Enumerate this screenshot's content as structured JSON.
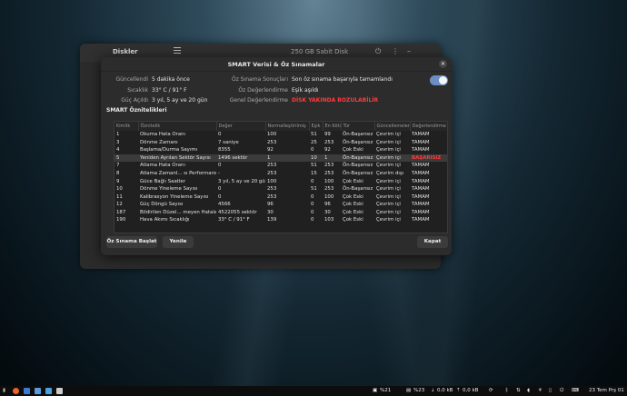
{
  "background_window": {
    "title": "Diskler",
    "subtitle": "250 GB Sabit Disk"
  },
  "dialog": {
    "title": "SMART Verisi & Öz Sınamalar",
    "info_left": [
      {
        "label": "Güncellendi",
        "value": "5 dakika önce"
      },
      {
        "label": "Sıcaklık",
        "value": "33° C / 91° F"
      },
      {
        "label": "Güç Açıldı",
        "value": "3 yıl, 5 ay ve 20 gün"
      }
    ],
    "info_right": [
      {
        "label": "Öz Sınama Sonuçları",
        "value": "Son öz sınama başarıyla tamamlandı"
      },
      {
        "label": "Öz Değerlendirme",
        "value": "Eşik aşıldı"
      },
      {
        "label": "Genel Değerlendirme",
        "value": "DİSK YAKINDA BOZULABİLİR"
      }
    ],
    "toggle_on": true,
    "section_title": "SMART Öznitelikleri",
    "columns": [
      "Kimlik",
      "Öznitelik",
      "Değer",
      "Normalleştirilmiş",
      "Eşik",
      "En Kötü",
      "Tür",
      "Güncellemeler",
      "Değerlendirme"
    ],
    "rows": [
      [
        "1",
        "Okuma Hata Oranı",
        "0",
        "100",
        "51",
        "99",
        "Ön-Başarısız",
        "Çevrim içi",
        "TAMAM"
      ],
      [
        "3",
        "Dönme Zamanı",
        "7 saniye",
        "253",
        "25",
        "253",
        "Ön-Başarısız",
        "Çevrim içi",
        "TAMAM"
      ],
      [
        "4",
        "Başlama/Durma Sayımı",
        "8355",
        "92",
        "0",
        "92",
        "Çok Eski",
        "Çevrim içi",
        "TAMAM"
      ],
      [
        "5",
        "Yeniden Ayrılan Sektör Sayısı",
        "1496 sektör",
        "1",
        "10",
        "1",
        "Ön-Başarısız",
        "Çevrim içi",
        "BAŞARISIZ"
      ],
      [
        "7",
        "Atlama Hata Oranı",
        "0",
        "253",
        "51",
        "253",
        "Ön-Başarısız",
        "Çevrim içi",
        "TAMAM"
      ],
      [
        "8",
        "Atlama Zamanl... sı Performansı",
        "-",
        "253",
        "15",
        "253",
        "Ön-Başarısız",
        "Çevrim dışı",
        "TAMAM"
      ],
      [
        "9",
        "Güce Bağlı Saatler",
        "3 yıl, 5 ay ve 20 gün",
        "100",
        "0",
        "100",
        "Çok Eski",
        "Çevrim içi",
        "TAMAM"
      ],
      [
        "10",
        "Dönme Yineleme Sayısı",
        "0",
        "253",
        "51",
        "253",
        "Ön-Başarısız",
        "Çevrim içi",
        "TAMAM"
      ],
      [
        "11",
        "Kalibrasyon Yineleme Sayısı",
        "0",
        "253",
        "0",
        "100",
        "Çok Eski",
        "Çevrim içi",
        "TAMAM"
      ],
      [
        "12",
        "Güç Döngü Sayısı",
        "4566",
        "96",
        "0",
        "96",
        "Çok Eski",
        "Çevrim içi",
        "TAMAM"
      ],
      [
        "187",
        "Bildirilen Düzel... meyen Hatalar",
        "4522055 sektör",
        "30",
        "0",
        "30",
        "Çok Eski",
        "Çevrim içi",
        "TAMAM"
      ],
      [
        "190",
        "Hava Akımı Sıcaklığı",
        "33° C / 91° F",
        "139",
        "0",
        "103",
        "Çok Eski",
        "Çevrim içi",
        "TAMAM"
      ]
    ],
    "selected_row": 3,
    "buttons": {
      "selftest": "Öz Sınama Başlat",
      "refresh": "Yenile",
      "close": "Kapat"
    }
  },
  "taskbar": {
    "cpu": "%21",
    "mem": "%23",
    "net_down": "0,0 kB",
    "net_up": "0,0 kB",
    "clock": "23 Tem Prş  01"
  },
  "colors": {
    "danger": "#ff3b3b",
    "accent": "#6c8ec4"
  }
}
